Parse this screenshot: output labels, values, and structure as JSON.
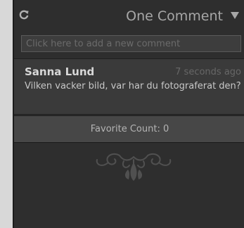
{
  "header": {
    "title": "One Comment",
    "refresh_icon": "refresh-icon",
    "collapse_icon": "triangle-down-icon"
  },
  "input": {
    "placeholder": "Click here to add a new comment"
  },
  "comments": [
    {
      "author": "Sanna Lund",
      "time": "7 seconds ago",
      "text": "Vilken vacker bild, var har du fotograferat den?"
    }
  ],
  "favorite": {
    "label": "Favorite Count: 0"
  },
  "colors": {
    "panel_background": "#2e2e2e",
    "outer_background": "#d8d8d8",
    "comment_background": "#3a3a3a",
    "favorite_background": "#474747"
  }
}
